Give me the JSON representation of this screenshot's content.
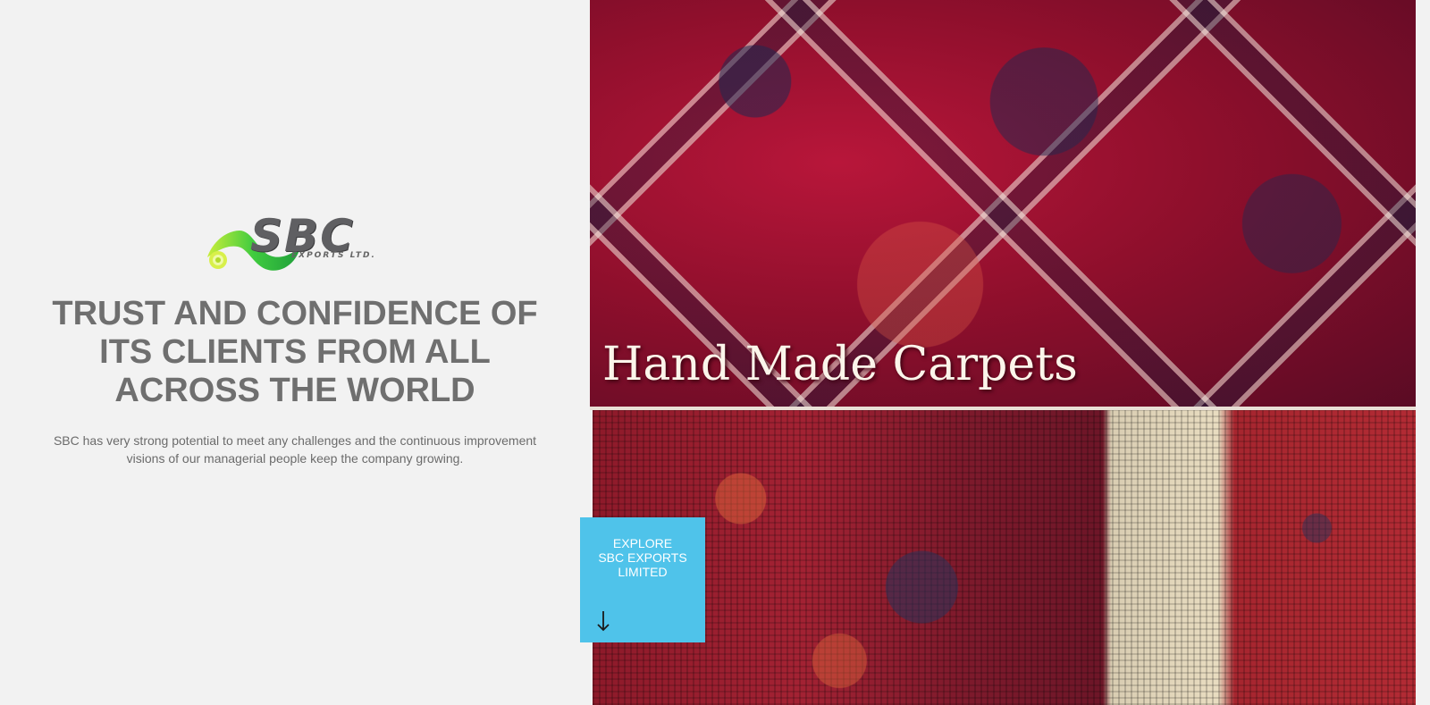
{
  "brand": {
    "name": "SBC",
    "subtitle": "EXPORTS LTD."
  },
  "hero": {
    "headline_lines": [
      "TRUST AND CONFIDENCE OF",
      "ITS CLIENTS FROM ALL",
      "ACROSS THE WORLD"
    ],
    "description": "SBC has very strong potential to meet any challenges and the continuous improvement visions of our managerial people keep the company growing."
  },
  "images": {
    "carpet_title": "Hand Made Carpets"
  },
  "explore": {
    "lines": [
      "EXPLORE",
      "SBC EXPORTS",
      "LIMITED"
    ],
    "icon": "arrow-down-icon"
  },
  "colors": {
    "background": "#f2f2f2",
    "headline": "#6f6f6f",
    "accent": "#4fc3ea",
    "logo_green": "#3cc43c"
  }
}
